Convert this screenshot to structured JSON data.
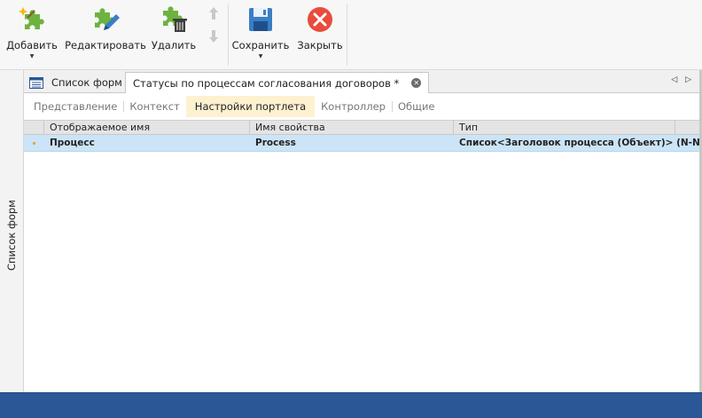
{
  "ribbon": {
    "add_label": "Добавить",
    "edit_label": "Редактировать",
    "delete_label": "Удалить",
    "save_label": "Сохранить",
    "close_label": "Закрыть"
  },
  "left_panel": {
    "tab_label": "Список форм"
  },
  "doc_tabs": [
    {
      "label": "Список форм"
    },
    {
      "label": "Статусы по процессам согласования договоров *"
    }
  ],
  "sub_tabs": [
    {
      "label": "Представление"
    },
    {
      "label": "Контекст"
    },
    {
      "label": "Настройки портлета"
    },
    {
      "label": "Контроллер"
    },
    {
      "label": "Общие"
    }
  ],
  "grid": {
    "columns": [
      "Отображаемое имя",
      "Имя свойства",
      "Тип"
    ],
    "rows": [
      {
        "display_name": "Процесс",
        "property_name": "Process",
        "type": "Список<Заголовок процесса (Объект)> (N-N)"
      }
    ]
  },
  "colors": {
    "statusbar": "#2b5797",
    "selected_row": "#cce4f7",
    "active_subtab": "#fdf1d0",
    "close_icon": "#e84c3d",
    "save_icon": "#3a7ec4",
    "puzzle_green": "#6db33f"
  }
}
